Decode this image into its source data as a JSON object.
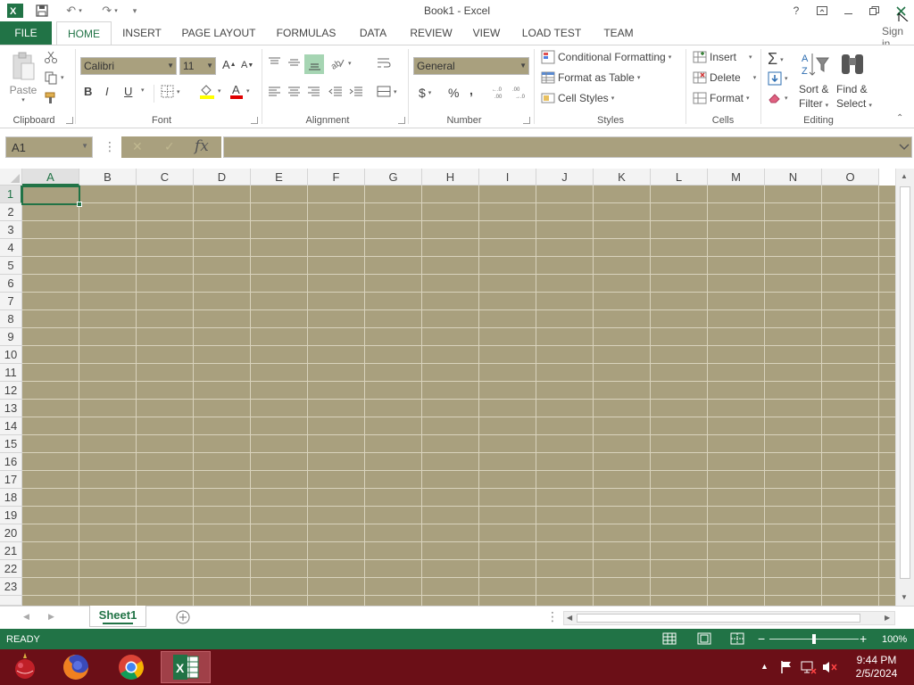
{
  "window": {
    "title": "Book1 - Excel",
    "help": "?",
    "signin": "Sign in"
  },
  "tabs": [
    {
      "label": "FILE"
    },
    {
      "label": "HOME"
    },
    {
      "label": "INSERT"
    },
    {
      "label": "PAGE LAYOUT"
    },
    {
      "label": "FORMULAS"
    },
    {
      "label": "DATA"
    },
    {
      "label": "REVIEW"
    },
    {
      "label": "VIEW"
    },
    {
      "label": "LOAD TEST"
    },
    {
      "label": "TEAM"
    }
  ],
  "ribbon": {
    "clipboard": {
      "label": "Clipboard",
      "paste": "Paste"
    },
    "font": {
      "label": "Font",
      "name": "Calibri",
      "size": "11",
      "bold": "B",
      "italic": "I",
      "underline": "U"
    },
    "alignment": {
      "label": "Alignment"
    },
    "number": {
      "label": "Number",
      "format": "General",
      "currency": "$",
      "percent": "%",
      "comma": ","
    },
    "styles": {
      "label": "Styles",
      "conditional": "Conditional Formatting",
      "format_table": "Format as Table",
      "cell_styles": "Cell Styles"
    },
    "cells": {
      "label": "Cells",
      "insert": "Insert",
      "delete": "Delete",
      "format": "Format"
    },
    "editing": {
      "label": "Editing",
      "sort1": "Sort &",
      "sort2": "Filter",
      "find1": "Find &",
      "find2": "Select"
    }
  },
  "formula_bar": {
    "namebox": "A1",
    "fx": "fx",
    "value": ""
  },
  "columns": [
    "A",
    "B",
    "C",
    "D",
    "E",
    "F",
    "G",
    "H",
    "I",
    "J",
    "K",
    "L",
    "M",
    "N",
    "O"
  ],
  "rows": [
    "1",
    "2",
    "3",
    "4",
    "5",
    "6",
    "7",
    "8",
    "9",
    "10",
    "11",
    "12",
    "13",
    "14",
    "15",
    "16",
    "17",
    "18",
    "19",
    "20",
    "21",
    "22",
    "23"
  ],
  "sheets": {
    "active": "Sheet1"
  },
  "status": {
    "text": "READY",
    "zoom": "100%",
    "zoom_fraction": 0.5
  },
  "taskbar": {
    "time": "9:44 PM",
    "date": "2/5/2024"
  },
  "colors": {
    "accent": "#217346",
    "cell_bg": "#a9a07e",
    "taskbar": "#6b0f17"
  }
}
